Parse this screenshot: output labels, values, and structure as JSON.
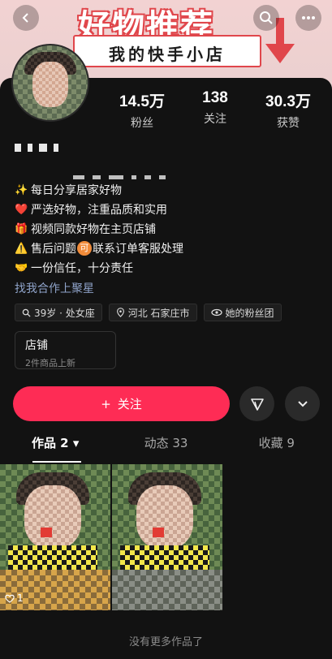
{
  "banner": {
    "title": "好物推荐",
    "subtitle": "我的快手小店",
    "accent": "#e0464b"
  },
  "top_bar": {
    "back_icon": "chevron-left-icon",
    "search_icon": "search-icon",
    "more_icon": "more-icon"
  },
  "profile": {
    "stats": [
      {
        "value": "14.5万",
        "label": "粉丝"
      },
      {
        "value": "138",
        "label": "关注"
      },
      {
        "value": "30.3万",
        "label": "获赞"
      }
    ],
    "bio": [
      {
        "emoji": "✨",
        "text": "每日分享居家好物"
      },
      {
        "emoji": "❤️",
        "text": "严选好物，注重品质和实用"
      },
      {
        "emoji": "🎁",
        "text": "视频同款好物在主页店铺"
      },
      {
        "emoji": "⚠️",
        "text_before": "售后问题",
        "badge": "可",
        "text_after": "联系订单客服处理"
      },
      {
        "emoji": "🤝",
        "text": "一份信任，十分责任"
      }
    ],
    "collab_link": "找我合作上聚星",
    "tags": [
      {
        "icon": "search-icon",
        "text": "39岁 · 处女座"
      },
      {
        "icon": "location-icon",
        "text": "河北 石家庄市"
      },
      {
        "icon": "fan-group-icon",
        "text": "她的粉丝团"
      }
    ]
  },
  "shop": {
    "title": "店铺",
    "subtitle": "2件商品上新"
  },
  "actions": {
    "follow_label": "关注",
    "follow_prefix": "+",
    "share_icon": "send-icon",
    "dropdown_icon": "chevron-down-icon",
    "follow_color": "#fe2c55"
  },
  "tabs": [
    {
      "label": "作品 2 ▾"
    },
    {
      "label": "动态 33"
    },
    {
      "label": "收藏 9"
    }
  ],
  "works": [
    {
      "likes": "1"
    }
  ],
  "footer_note": "没有更多作品了"
}
